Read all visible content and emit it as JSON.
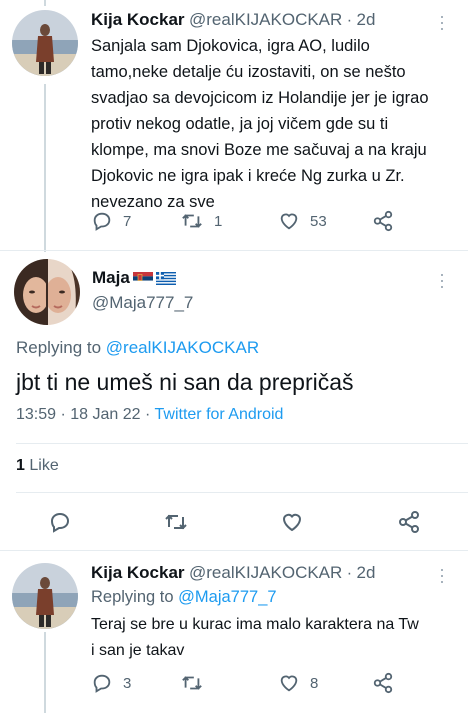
{
  "tweet1": {
    "name": "Kija Kockar",
    "handle": "@realKIJAKOCKAR",
    "time": "2d",
    "lines": [
      "Sanjala sam Djokovica, igra AO, ludilo",
      "tamo,neke detalje ću izostaviti, on se nešto",
      "svadjao sa devojcicom iz Holandije jer je igrao",
      "protiv nekog odatle, ja joj vičem gde su ti",
      "klompe, ma snovi Boze me sačuvaj a na kraju",
      "Djokovic ne igra ipak i kreće Ng zurka u Zr.",
      "nevezano za sve"
    ],
    "reply_count": "7",
    "retweet_count": "1",
    "like_count": "53"
  },
  "tweet2": {
    "name": "Maja",
    "flags": [
      "serbia-flag",
      "greece-flag"
    ],
    "handle": "@Maja777_7",
    "replying_label": "Replying to",
    "replying_handle": "@realKIJAKOCKAR",
    "text": "jbt ti ne umeš ni san da prepričaš",
    "time": "13:59",
    "date": "18 Jan 22",
    "source": "Twitter for Android",
    "likes_count": "1",
    "likes_label": "Like"
  },
  "tweet3": {
    "name": "Kija Kockar",
    "handle": "@realKIJAKOCKAR",
    "time": "2d",
    "replying_label": "Replying to",
    "replying_handle": "@Maja777_7",
    "lines": [
      "Teraj se bre u kurac ima malo karaktera na Tw",
      "i san je takav"
    ],
    "reply_count": "3",
    "retweet_count": "",
    "like_count": "8"
  },
  "colors": {
    "accent": "#1d9bf0",
    "secondary_text": "#536471",
    "primary_text": "#0f1419",
    "divider": "#e6ecf0"
  }
}
